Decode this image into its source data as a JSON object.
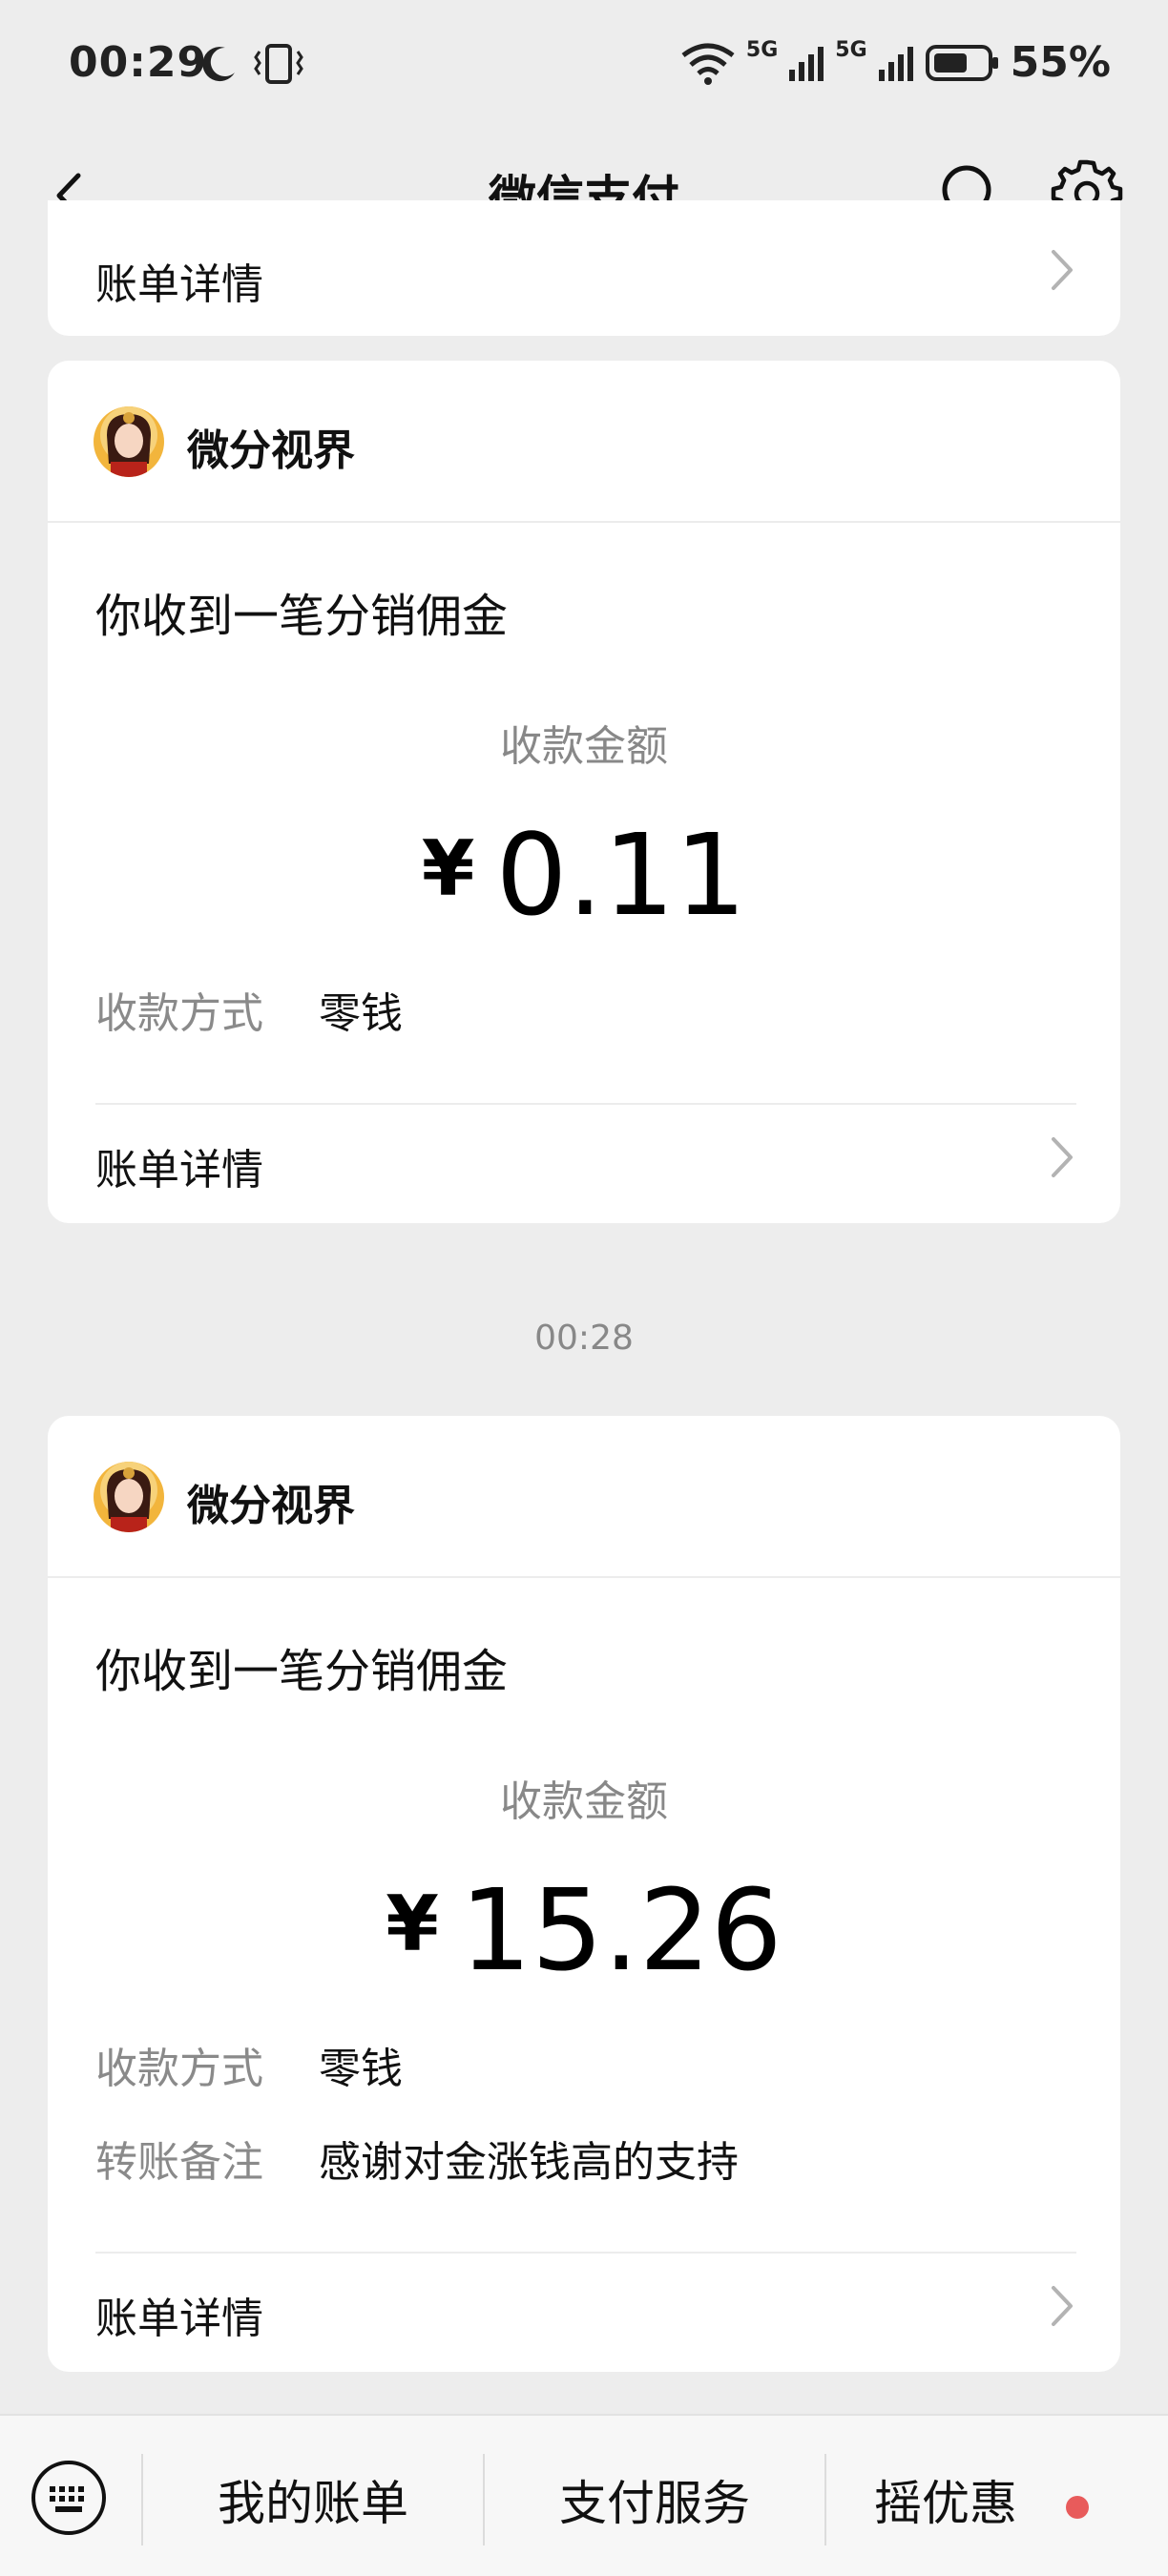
{
  "status_bar": {
    "time": "00:29",
    "network_1": "5G",
    "network_2": "5G",
    "battery": "55%",
    "icons": [
      "moon-icon",
      "vibrate-icon",
      "wifi-icon",
      "signal-icon",
      "signal-icon",
      "battery-icon"
    ]
  },
  "nav": {
    "title": "微信支付",
    "icons": [
      "back-icon",
      "search-icon",
      "settings-icon"
    ]
  },
  "top_card": {
    "detail_label": "账单详情"
  },
  "messages": [
    {
      "merchant": "微分视界",
      "title": "你收到一笔分销佣金",
      "amount_label": "收款金额",
      "currency": "¥",
      "amount": "0.11",
      "rows": [
        {
          "label": "收款方式",
          "value": "零钱"
        }
      ],
      "detail_label": "账单详情"
    },
    {
      "merchant": "微分视界",
      "title": "你收到一笔分销佣金",
      "amount_label": "收款金额",
      "currency": "¥",
      "amount": "15.26",
      "rows": [
        {
          "label": "收款方式",
          "value": "零钱"
        },
        {
          "label": "转账备注",
          "value": "感谢对金涨钱高的支持"
        }
      ],
      "detail_label": "账单详情"
    }
  ],
  "time_separator": "00:28",
  "bottom_bar": {
    "tabs": [
      {
        "label": "我的账单"
      },
      {
        "label": "支付服务"
      },
      {
        "label": "摇优惠"
      }
    ],
    "accent_dot_color": "#e85b5b"
  }
}
